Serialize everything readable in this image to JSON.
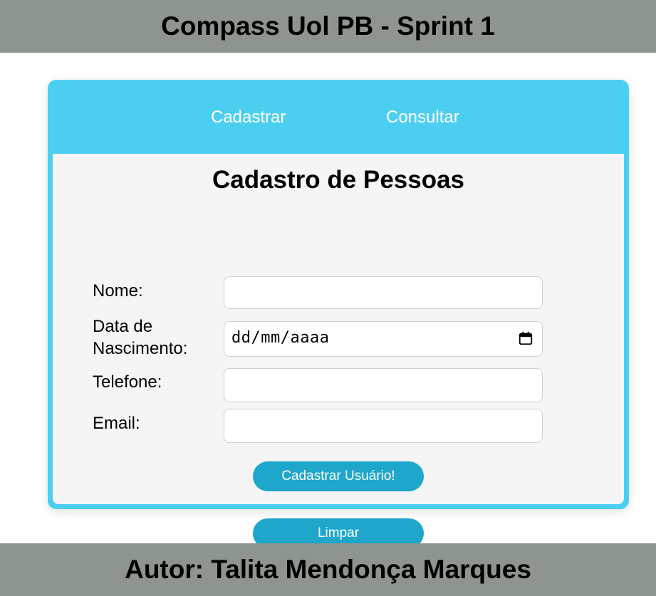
{
  "header": {
    "title": "Compass Uol PB - Sprint 1"
  },
  "nav": {
    "items": [
      {
        "label": "Cadastrar"
      },
      {
        "label": "Consultar"
      }
    ]
  },
  "form": {
    "title": "Cadastro de Pessoas",
    "fields": [
      {
        "label": "Nome:",
        "value": ""
      },
      {
        "label_line1": "Data de",
        "label_line2": "Nascimento:",
        "value": "dd/mm/aaaa",
        "icon": "calendar-icon"
      },
      {
        "label": "Telefone:",
        "value": ""
      },
      {
        "label": "Email:",
        "value": ""
      }
    ],
    "submit_label": "Cadastrar Usuário!",
    "clear_label": "Limpar"
  },
  "footer": {
    "text": "Autor: Talita Mendonça Marques"
  },
  "colors": {
    "bar_background": "#8e958e",
    "card_accent": "#4ccef0",
    "button": "#1ea6cb",
    "form_background": "#f5f5f5"
  }
}
